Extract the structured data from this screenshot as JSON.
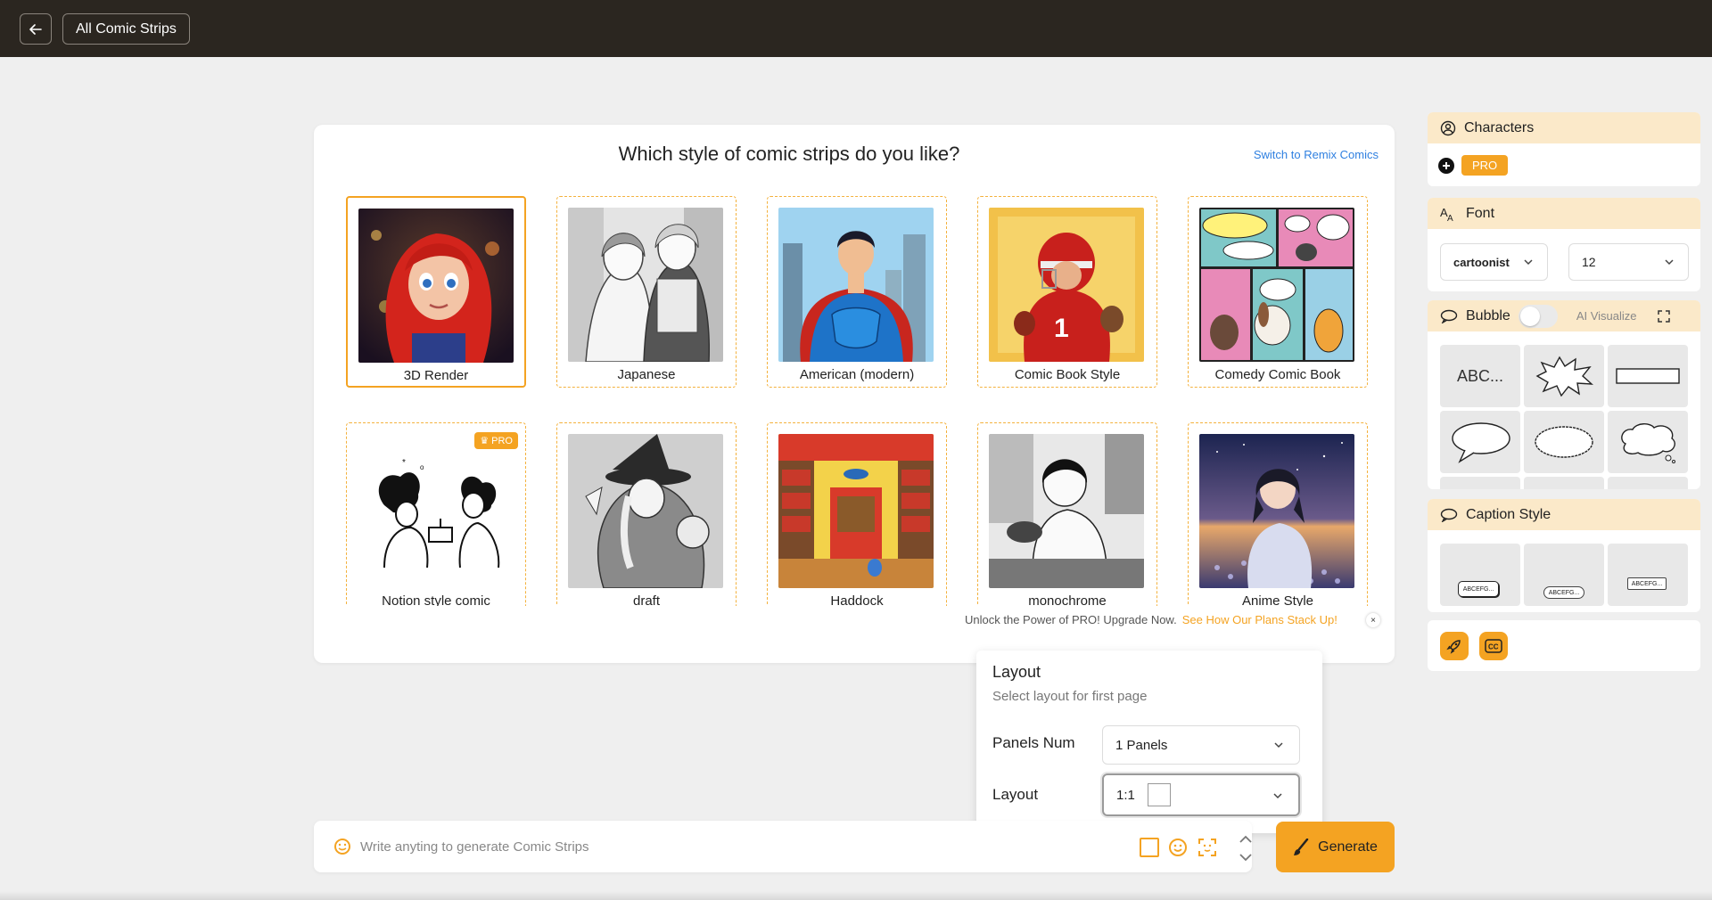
{
  "topbar": {
    "back_icon": "arrow-left-icon",
    "all_label": "All Comic Strips"
  },
  "main": {
    "title": "Which style of comic strips do you like?",
    "switch_link": "Switch to Remix Comics",
    "styles": [
      {
        "label": "3D Render",
        "selected": true,
        "pro": false
      },
      {
        "label": "Japanese",
        "selected": false,
        "pro": false
      },
      {
        "label": "American (modern)",
        "selected": false,
        "pro": false
      },
      {
        "label": "Comic Book Style",
        "selected": false,
        "pro": false
      },
      {
        "label": "Comedy Comic Book",
        "selected": false,
        "pro": false
      },
      {
        "label": "Notion style comic",
        "selected": false,
        "pro": true
      },
      {
        "label": "draft",
        "selected": false,
        "pro": false
      },
      {
        "label": "Haddock",
        "selected": false,
        "pro": false
      },
      {
        "label": "monochrome",
        "selected": false,
        "pro": false
      },
      {
        "label": "Anime Style",
        "selected": false,
        "pro": false
      }
    ],
    "pro_badge": "PRO",
    "upgrade_text": "Unlock the Power of PRO! Upgrade Now.",
    "upgrade_link": "See How Our Plans Stack Up!",
    "upgrade_close": "×"
  },
  "layout_popup": {
    "title": "Layout",
    "subtitle": "Select layout for first page",
    "panels_label": "Panels Num",
    "panels_value": "1 Panels",
    "layout_label": "Layout",
    "layout_value": "1:1"
  },
  "prompt": {
    "placeholder": "Write anyting to generate Comic Strips",
    "generate_label": "Generate"
  },
  "right_panel": {
    "characters": {
      "title": "Characters",
      "pro_label": "PRO"
    },
    "font": {
      "title": "Font",
      "family_value": "cartoonist",
      "size_value": "12"
    },
    "bubble": {
      "title": "Bubble",
      "ai_label": "AI Visualize",
      "first_cell_text": "ABC..."
    },
    "caption": {
      "title": "Caption Style",
      "cell_texts": [
        "ABCEFG...",
        "ABCEFG...",
        "ABCEFG..."
      ]
    }
  },
  "colors": {
    "accent": "#f4a322",
    "topbar": "#2b2620",
    "panel_header": "#fbe9c9",
    "link": "#2e7fe0"
  }
}
